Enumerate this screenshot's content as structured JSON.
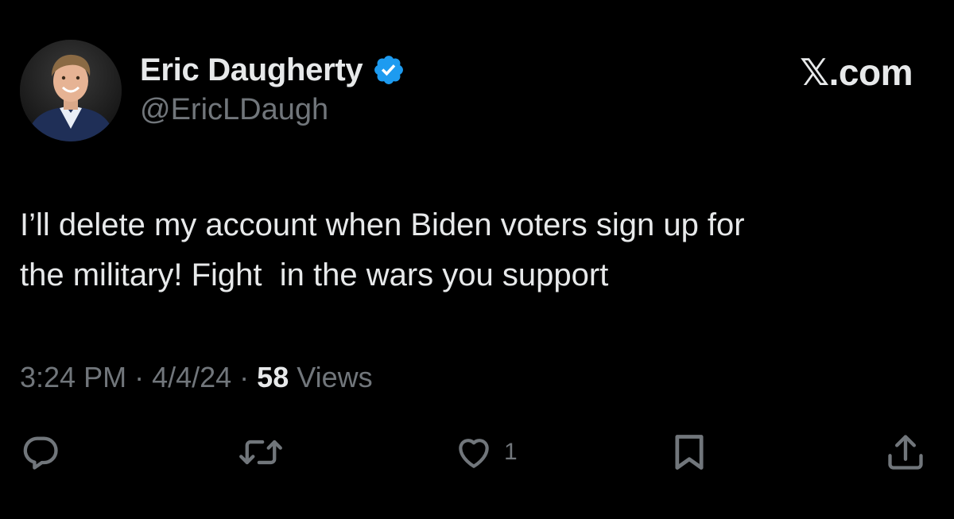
{
  "author": {
    "display_name": "Eric Daugherty",
    "handle": "@EricLDaugh",
    "verified": true
  },
  "brand": {
    "label": "𝕏.com"
  },
  "tweet": {
    "text": "I’ll delete my account when Biden voters sign up for\nthe military! Fight  in the wars you support"
  },
  "meta": {
    "time": "3:24 PM",
    "separator": "·",
    "date": "4/4/24",
    "views_count": "58",
    "views_label": "Views"
  },
  "actions": [
    {
      "name": "reply",
      "icon": "reply-icon",
      "count": ""
    },
    {
      "name": "retweet",
      "icon": "retweet-icon",
      "count": ""
    },
    {
      "name": "like",
      "icon": "heart-icon",
      "count": "1"
    },
    {
      "name": "bookmark",
      "icon": "bookmark-icon",
      "count": ""
    },
    {
      "name": "share",
      "icon": "share-icon",
      "count": ""
    }
  ],
  "colors": {
    "background": "#000000",
    "primary_text": "#e7e9ea",
    "secondary_text": "#71767b",
    "verified_badge": "#1d9bf0"
  }
}
